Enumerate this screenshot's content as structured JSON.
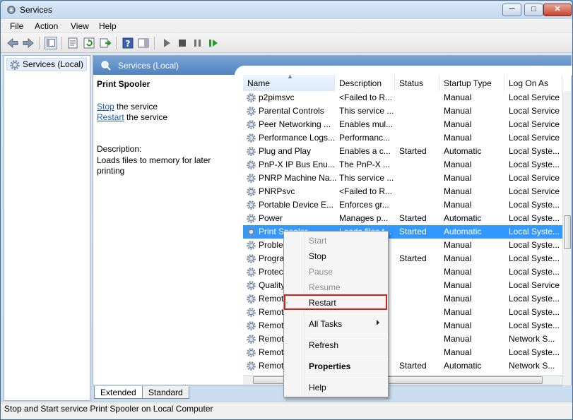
{
  "window": {
    "title": "Services"
  },
  "menubar": [
    "File",
    "Action",
    "View",
    "Help"
  ],
  "tree": {
    "root_label": "Services (Local)"
  },
  "panel": {
    "header_title": "Services (Local)",
    "selected_service": "Print Spooler",
    "stop_link": "Stop",
    "stop_suffix": " the service",
    "restart_link": "Restart",
    "restart_suffix": " the service",
    "description_label": "Description:",
    "description_text": "Loads files to memory for later printing"
  },
  "list": {
    "columns": [
      "Name",
      "Description",
      "Status",
      "Startup Type",
      "Log On As"
    ],
    "rows": [
      {
        "name": "p2pimsvc",
        "description": "<Failed to R...",
        "status": "",
        "startup": "Manual",
        "logon": "Local Service"
      },
      {
        "name": "Parental Controls",
        "description": "This service ...",
        "status": "",
        "startup": "Manual",
        "logon": "Local Service"
      },
      {
        "name": "Peer Networking ...",
        "description": "Enables mul...",
        "status": "",
        "startup": "Manual",
        "logon": "Local Service"
      },
      {
        "name": "Performance Logs...",
        "description": "Performanc...",
        "status": "",
        "startup": "Manual",
        "logon": "Local Service"
      },
      {
        "name": "Plug and Play",
        "description": "Enables a c...",
        "status": "Started",
        "startup": "Automatic",
        "logon": "Local Syste..."
      },
      {
        "name": "PnP-X IP Bus Enu...",
        "description": "The PnP-X ...",
        "status": "",
        "startup": "Manual",
        "logon": "Local Syste..."
      },
      {
        "name": "PNRP Machine Na...",
        "description": "This service ...",
        "status": "",
        "startup": "Manual",
        "logon": "Local Service"
      },
      {
        "name": "PNRPsvc",
        "description": "<Failed to R...",
        "status": "",
        "startup": "Manual",
        "logon": "Local Service"
      },
      {
        "name": "Portable Device E...",
        "description": "Enforces gr...",
        "status": "",
        "startup": "Manual",
        "logon": "Local Syste..."
      },
      {
        "name": "Power",
        "description": "Manages p...",
        "status": "Started",
        "startup": "Automatic",
        "logon": "Local Syste..."
      },
      {
        "name": "Print Spooler",
        "description": "Loads files t...",
        "status": "Started",
        "startup": "Automatic",
        "logon": "Local Syste..."
      },
      {
        "name": "Problem Reports...",
        "description": "",
        "status": "",
        "startup": "Manual",
        "logon": "Local Syste..."
      },
      {
        "name": "Program Compati...",
        "description": "",
        "status": "Started",
        "startup": "Manual",
        "logon": "Local Syste..."
      },
      {
        "name": "Protected Storage",
        "description": "",
        "status": "",
        "startup": "Manual",
        "logon": "Local Syste..."
      },
      {
        "name": "Quality Windows ...",
        "description": "",
        "status": "",
        "startup": "Manual",
        "logon": "Local Service"
      },
      {
        "name": "Remote Access A...",
        "description": "",
        "status": "",
        "startup": "Manual",
        "logon": "Local Syste..."
      },
      {
        "name": "Remote Access C...",
        "description": "",
        "status": "",
        "startup": "Manual",
        "logon": "Local Syste..."
      },
      {
        "name": "Remote Desktop ...",
        "description": "",
        "status": "",
        "startup": "Manual",
        "logon": "Local Syste..."
      },
      {
        "name": "Remote Desktop ...",
        "description": "",
        "status": "",
        "startup": "Manual",
        "logon": "Network S..."
      },
      {
        "name": "Remote Desktop ...",
        "description": "",
        "status": "",
        "startup": "Manual",
        "logon": "Local Syste..."
      },
      {
        "name": "Remote Procedur...",
        "description": "",
        "status": "Started",
        "startup": "Automatic",
        "logon": "Network S..."
      }
    ],
    "selected_index": 10
  },
  "context_menu": {
    "start": "Start",
    "stop": "Stop",
    "pause": "Pause",
    "resume": "Resume",
    "restart": "Restart",
    "all_tasks": "All Tasks",
    "refresh": "Refresh",
    "properties": "Properties",
    "help": "Help"
  },
  "tabs": [
    "Extended",
    "Standard"
  ],
  "statusbar": {
    "text": "Stop and Start service Print Spooler on Local Computer"
  },
  "colors": {
    "selection": "#3399ff",
    "header_blue": "#4f83c0",
    "highlight_box": "#d21f1f"
  },
  "icons": [
    "gear-icon",
    "back-arrow-icon",
    "forward-arrow-icon",
    "play-icon",
    "stop-icon",
    "pause-icon",
    "restart-icon",
    "help-icon"
  ]
}
